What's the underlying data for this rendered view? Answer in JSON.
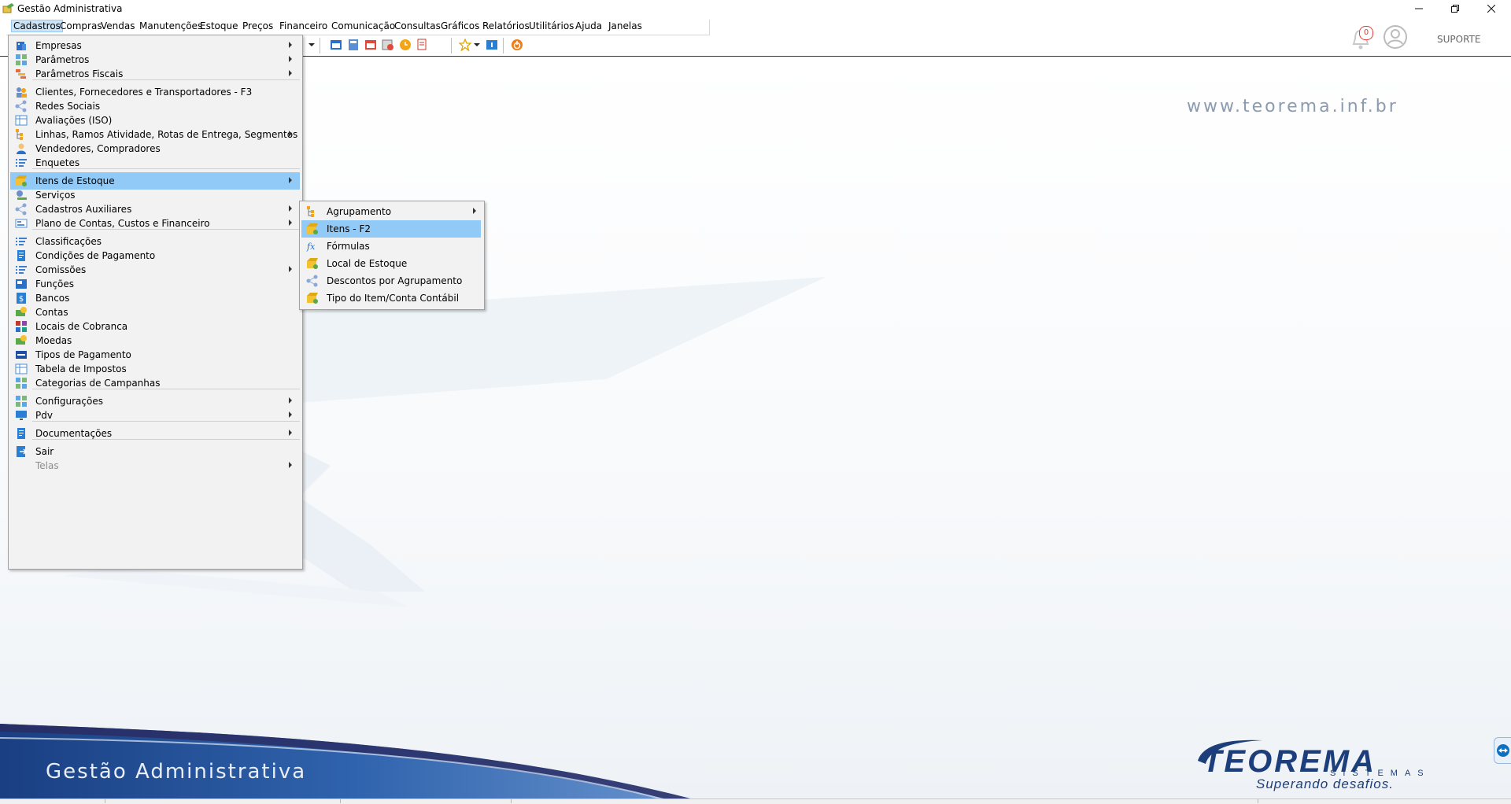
{
  "window": {
    "title": "Gestão Administrativa"
  },
  "menubar": [
    "Cadastros",
    "Compras",
    "Vendas",
    "Manutenções",
    "Estoque",
    "Preços",
    "Financeiro",
    "Comunicação",
    "Consultas",
    "Gráficos",
    "Relatórios",
    "Utilitários",
    "Ajuda",
    "Janelas"
  ],
  "notifications": {
    "count": "0"
  },
  "user": {
    "label": "SUPORTE"
  },
  "website": "www.teorema.inf.br",
  "cadastros_menu": [
    {
      "label": "Empresas",
      "icon": "building-icon"
    },
    {
      "label": "Parâmetros",
      "icon": "grid-icon"
    },
    {
      "label": "Parâmetros Fiscais",
      "icon": "fiscal-icon"
    },
    {
      "label": "Clientes, Fornecedores e Transportadores - F3",
      "icon": "people-icon"
    },
    {
      "label": "Redes Sociais",
      "icon": "network-icon"
    },
    {
      "label": "Avaliações (ISO)",
      "icon": "table-icon"
    },
    {
      "label": "Linhas, Ramos Atividade, Rotas de Entrega, Segmentos",
      "icon": "tree-icon"
    },
    {
      "label": "Vendedores, Compradores",
      "icon": "person-icon"
    },
    {
      "label": "Enquetes",
      "icon": "list-icon"
    },
    {
      "label": "Itens de Estoque",
      "icon": "box-icon"
    },
    {
      "label": "Serviços",
      "icon": "service-icon"
    },
    {
      "label": "Cadastros Auxiliares",
      "icon": "network-icon"
    },
    {
      "label": "Plano de Contas, Custos e Financeiro",
      "icon": "accounts-icon"
    },
    {
      "label": "Classificações",
      "icon": "list-icon"
    },
    {
      "label": "Condições de Pagamento",
      "icon": "document-icon"
    },
    {
      "label": "Comissões",
      "icon": "list-icon"
    },
    {
      "label": "Funções",
      "icon": "function-icon"
    },
    {
      "label": "Bancos",
      "icon": "bank-icon"
    },
    {
      "label": "Contas",
      "icon": "money-icon"
    },
    {
      "label": "Locais de Cobranca",
      "icon": "blocks-icon"
    },
    {
      "label": "Moedas",
      "icon": "money-icon"
    },
    {
      "label": "Tipos de Pagamento",
      "icon": "card-icon"
    },
    {
      "label": "Tabela de Impostos",
      "icon": "table-icon"
    },
    {
      "label": "Categorias de Campanhas",
      "icon": "grid-icon"
    },
    {
      "label": "Configurações",
      "icon": "grid-icon"
    },
    {
      "label": "Pdv",
      "icon": "monitor-icon"
    },
    {
      "label": "Documentações",
      "icon": "document-icon"
    },
    {
      "label": "Sair",
      "icon": "exit-icon"
    },
    {
      "label": "Telas",
      "icon": ""
    }
  ],
  "itens_submenu": [
    {
      "label": "Agrupamento",
      "icon": "tree-icon"
    },
    {
      "label": "Itens - F2",
      "icon": "box-icon"
    },
    {
      "label": "Fórmulas",
      "icon": "formula-icon"
    },
    {
      "label": "Local de Estoque",
      "icon": "box-icon"
    },
    {
      "label": "Descontos por Agrupamento",
      "icon": "network-icon"
    },
    {
      "label": "Tipo do Item/Conta Contábil",
      "icon": "box-icon"
    }
  ],
  "banner": {
    "text": "Gestão Administrativa",
    "logo": "TEOREMA",
    "logo_sub": "SISTEMAS",
    "tagline": "Superando desafios."
  },
  "colors": {
    "highlight": "#91c9f7",
    "brand": "#1c3e7a"
  }
}
